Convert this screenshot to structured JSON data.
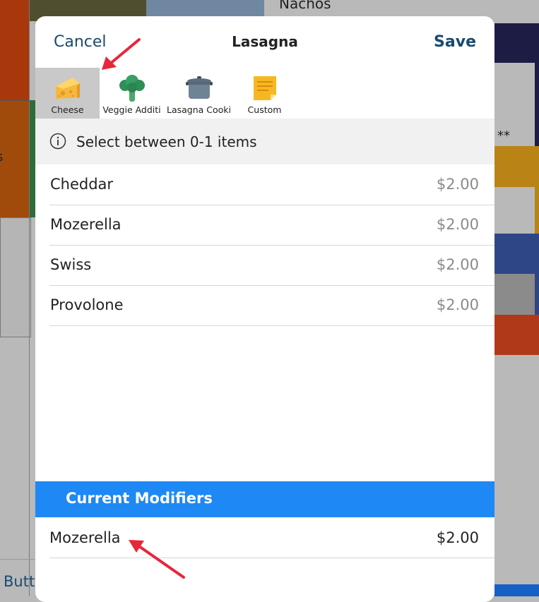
{
  "background": {
    "top_item_label": "Nachos",
    "bottom_button_label": "Butto",
    "left_edge_glyph": "s",
    "right_edge_mark": "**"
  },
  "modal": {
    "title": "Lasagna",
    "cancel_label": "Cancel",
    "save_label": "Save"
  },
  "tabs": [
    {
      "label": "Cheese",
      "icon": "cheese-icon",
      "active": true
    },
    {
      "label": "Veggie Additi",
      "icon": "broccoli-icon",
      "active": false
    },
    {
      "label": "Lasagna Cooki",
      "icon": "pot-icon",
      "active": false
    },
    {
      "label": "Custom",
      "icon": "sticky-note-icon",
      "active": false
    }
  ],
  "info": {
    "text": "Select between 0-1 items",
    "icon": "info-icon"
  },
  "options": [
    {
      "name": "Cheddar",
      "price": "$2.00"
    },
    {
      "name": "Mozerella",
      "price": "$2.00"
    },
    {
      "name": "Swiss",
      "price": "$2.00"
    },
    {
      "name": "Provolone",
      "price": "$2.00"
    }
  ],
  "current_modifiers": {
    "title": "Current Modifiers",
    "items": [
      {
        "name": "Mozerella",
        "price": "$2.00"
      }
    ]
  },
  "colors": {
    "accent_blue": "#1e88f5",
    "nav_text": "#1a4a6e",
    "annotation_red": "#e8263a"
  }
}
